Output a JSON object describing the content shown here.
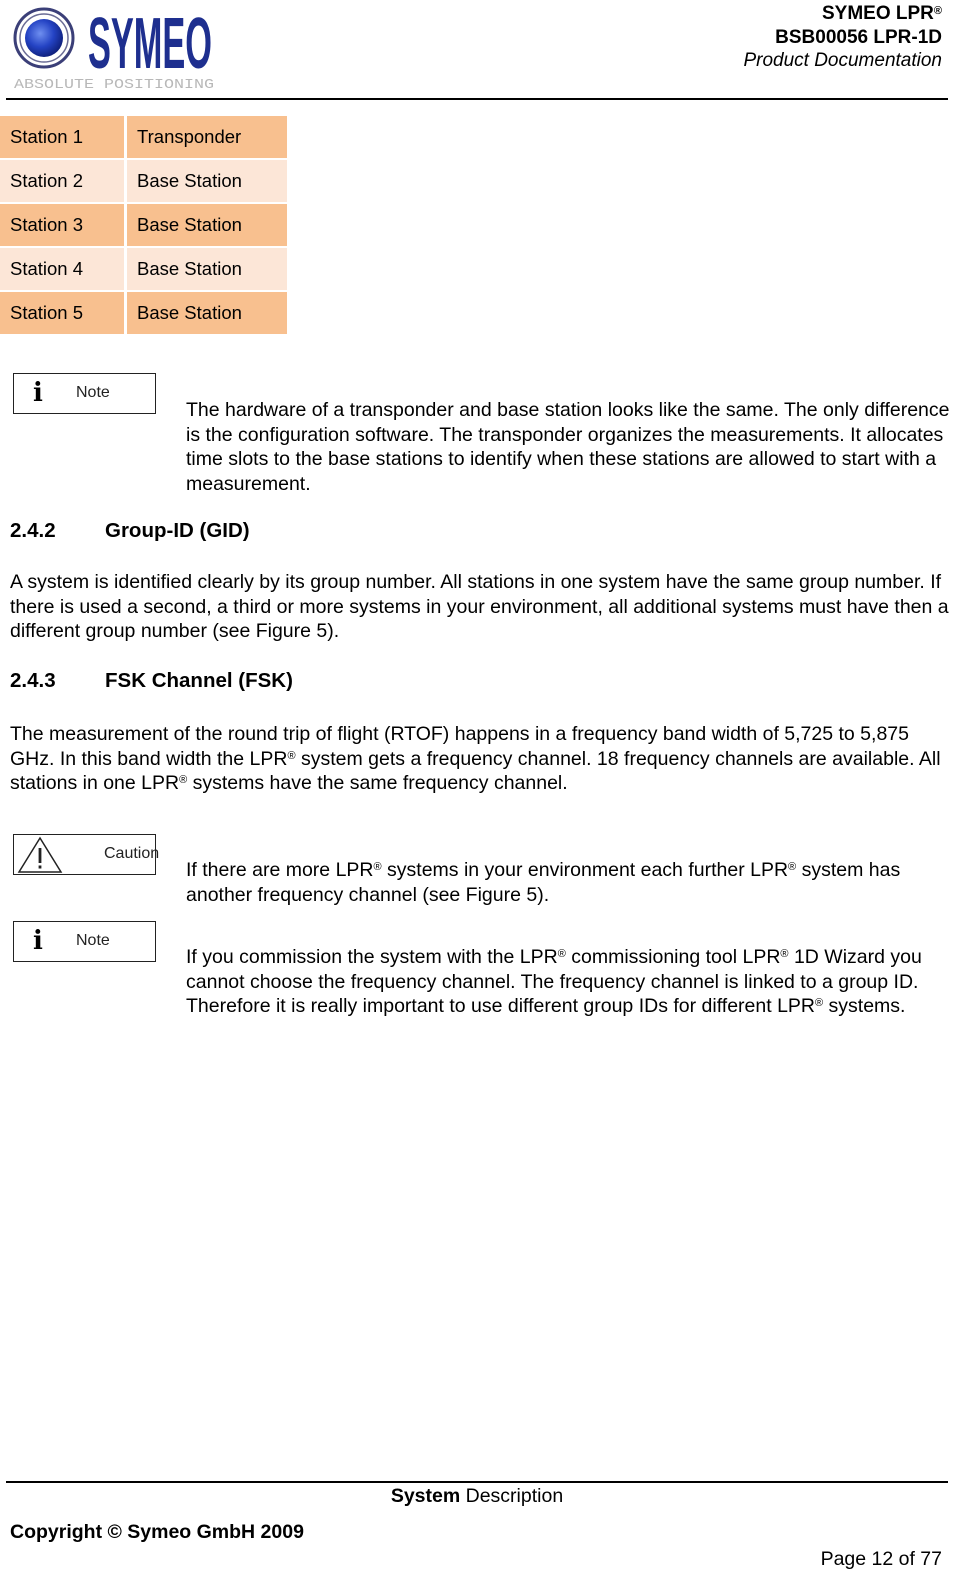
{
  "header": {
    "logo": {
      "brand": "SYMEO",
      "tagline": "ABSOLUTE POSITIONING",
      "icon": "symeo-target-logo-icon",
      "brand_color": "#1e2f8f",
      "tagline_color": "#b8b8b8"
    },
    "product_line": "SYMEO LPR",
    "product_line_mark": "®",
    "doc_id": "BSB00056 LPR-1D",
    "doc_type": "Product Documentation"
  },
  "station_table": {
    "colors": {
      "dark_row": "#f8c08f",
      "light_row": "#fce6d7"
    },
    "rows": [
      {
        "station": "Station 1",
        "role": "Transponder"
      },
      {
        "station": "Station 2",
        "role": "Base Station"
      },
      {
        "station": "Station 3",
        "role": "Base Station"
      },
      {
        "station": "Station 4",
        "role": "Base Station"
      },
      {
        "station": "Station 5",
        "role": "Base Station"
      }
    ]
  },
  "callouts": {
    "note_label": "Note",
    "caution_label": "Caution",
    "note_icon": "info-i-icon",
    "caution_icon": "warning-triangle-icon"
  },
  "note1": {
    "text": "The hardware of a transponder and base station looks like the same. The only difference is the configuration software. The transponder organizes the measurements. It allocates time slots to the base stations to identify when these stations are allowed to start with a measurement."
  },
  "section_242": {
    "number": "2.4.2",
    "title": "Group-ID (GID)",
    "body": "A system is identified clearly by its group number. All stations in one system have the same group number. If there is used a second, a third or more systems in your environment, all additional systems must have then a different group number (see Figure 5)."
  },
  "section_243": {
    "number": "2.4.3",
    "title": "FSK Channel (FSK)",
    "body_parts": [
      "The measurement of the round trip of flight (RTOF) happens in a frequency band width of 5,725 to 5,875 GHz. In this band width the LPR",
      "®",
      " system gets a frequency channel. 18 frequency channels are available. All stations in one LPR",
      "®",
      " systems have the same frequency channel."
    ]
  },
  "caution1": {
    "parts": [
      "If there are more LPR",
      "®",
      " systems in your environment each further LPR",
      "®",
      " system has another frequency channel (see Figure 5)."
    ]
  },
  "note2": {
    "parts": [
      "If you commission the system with the LPR",
      "®",
      " commissioning tool LPR",
      "®",
      " 1D Wizard you cannot choose the frequency channel. The frequency channel is linked to a group ID. Therefore it is really important to use different group IDs for different LPR",
      "®",
      " systems."
    ]
  },
  "footer": {
    "section_bold": "System",
    "section_rest": " Description",
    "copyright": "Copyright © Symeo GmbH 2009",
    "page": "Page 12 of 77"
  }
}
